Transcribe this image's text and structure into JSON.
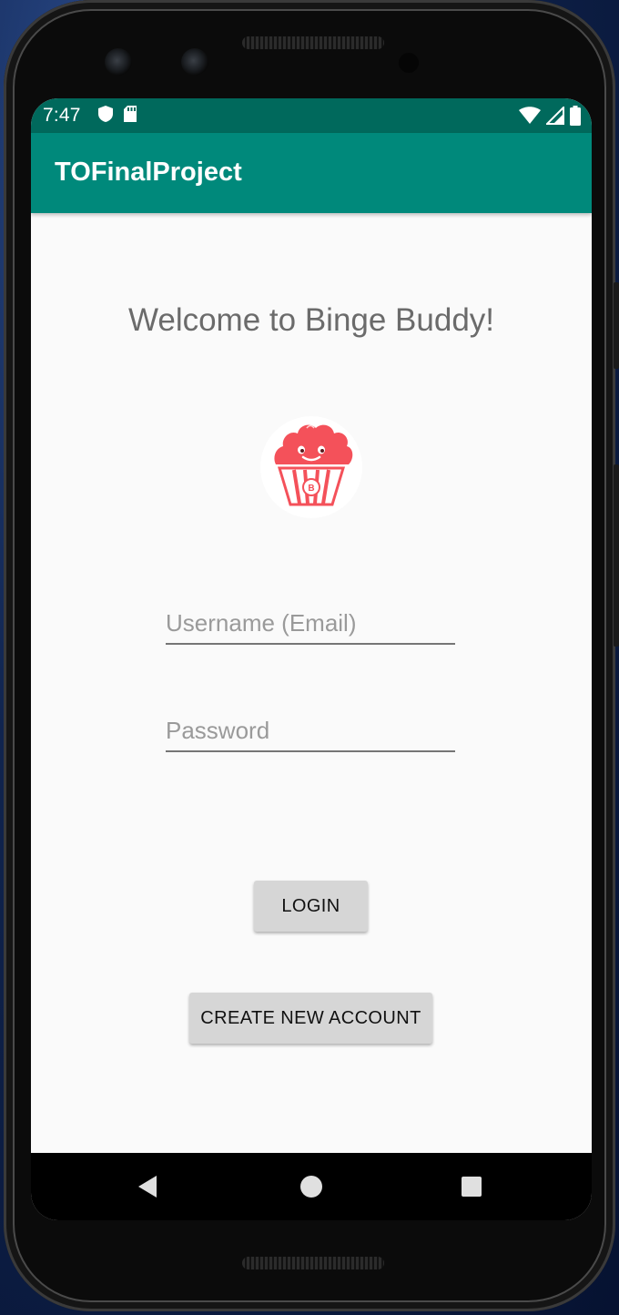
{
  "status_bar": {
    "time": "7:47",
    "icons_left": [
      "shield-icon",
      "sd-card-icon"
    ],
    "icons_right": [
      "wifi-icon",
      "cell-signal-icon",
      "battery-icon"
    ],
    "color": "#00695c"
  },
  "app_bar": {
    "title": "TOFinalProject",
    "color": "#00897b"
  },
  "main": {
    "welcome_text": "Welcome to Binge Buddy!",
    "logo_icon": "popcorn-logo-icon",
    "username_placeholder": "Username (Email)",
    "password_placeholder": "Password",
    "login_label": "LOGIN",
    "create_account_label": "CREATE NEW ACCOUNT",
    "accent_color": "#f4515a"
  },
  "nav_bar": {
    "icons": [
      "back-icon",
      "home-icon",
      "recents-icon"
    ]
  }
}
